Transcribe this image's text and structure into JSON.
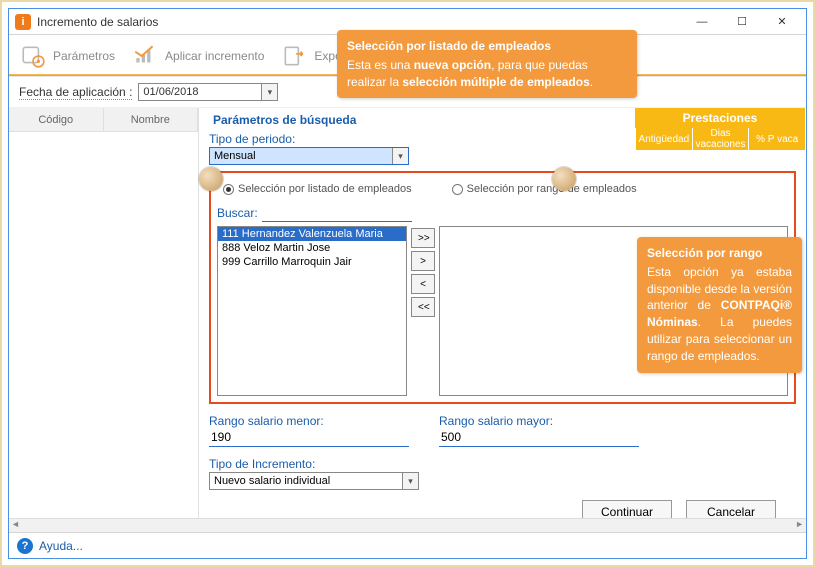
{
  "window": {
    "title": "Incremento de salarios"
  },
  "toolbar": {
    "params": "Parámetros",
    "apply": "Aplicar incremento",
    "export": "Exportar  "
  },
  "date": {
    "label": "Fecha de aplicación :",
    "value": "01/06/2018"
  },
  "left_columns": {
    "code": "Código",
    "name": "Nombre"
  },
  "params_panel": {
    "group": "Parámetros de búsqueda",
    "tipo_periodo_label": "Tipo de periodo:",
    "tipo_periodo_value": "Mensual",
    "radio_list": "Selección por listado de empleados",
    "radio_range": "Selección por rango de empleados",
    "buscar_label": "Buscar:",
    "buscar_value": "",
    "employees": [
      "111 Hernandez Valenzuela Maria",
      "888 Veloz Martin Jose",
      "999 Carrillo Marroquin Jair"
    ],
    "btn_add_all": ">>",
    "btn_add": ">",
    "btn_remove": "<",
    "btn_remove_all": "<<",
    "rango_menor_label": "Rango salario menor:",
    "rango_menor_value": "190",
    "rango_mayor_label": "Rango  salario mayor:",
    "rango_mayor_value": "500",
    "tipo_inc_label": "Tipo de Incremento:",
    "tipo_inc_value": "Nuevo salario individual",
    "continuar": "Continuar",
    "cancelar": "Cancelar"
  },
  "prestaciones": {
    "header": "Prestaciones",
    "cols": [
      "Antigüedad",
      "Dias vacaciones",
      "% P vaca"
    ]
  },
  "help": {
    "label": "Ayuda..."
  },
  "callouts": {
    "c1": {
      "title": "Selección por listado de empleados",
      "line1": "Esta es una ",
      "bold1": "nueva opción",
      "line2": ", para que puedas realizar la ",
      "bold2": "selección múltiple de empleados",
      "line3": "."
    },
    "c2": {
      "title": "Selección por rango",
      "line1": "Esta opción ya estaba disponible desde la versión anterior de ",
      "bold1": "CONTPAQi® Nóminas",
      "line2": ". La puedes utilizar para seleccionar un rango de empleados."
    }
  }
}
